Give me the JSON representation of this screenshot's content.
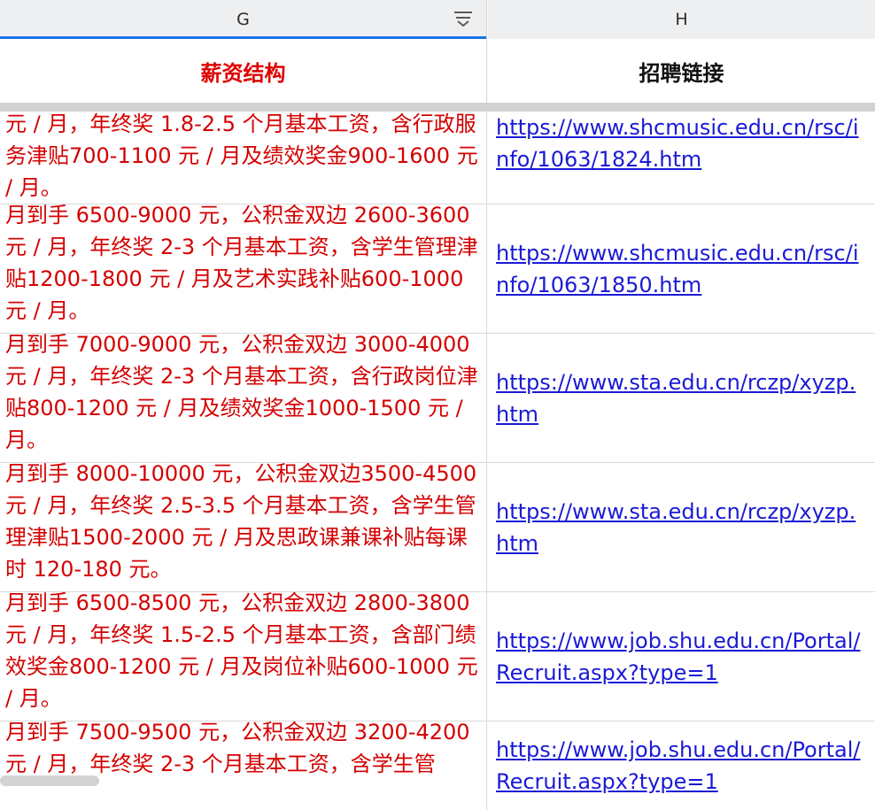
{
  "column_headers": {
    "g": "G",
    "h": "H"
  },
  "header_row": {
    "g": "薪资结构",
    "h": "招聘链接"
  },
  "icons": {
    "filter": "filter-dropdown-icon"
  },
  "colors": {
    "accent": "#1a73e8",
    "salary_text": "#d40000",
    "link": "#1a1ad6"
  },
  "rows": [
    {
      "salary": "元 / 月，年终奖 1.8-2.5 个月基本工资，含行政服务津贴700-1100 元 / 月及绩效奖金900-1600 元 / 月。",
      "link": "https://www.shcmusic.edu.cn/rsc/info/1063/1824.htm"
    },
    {
      "salary": "月到手 6500-9000 元，公积金双边 2600-3600 元 / 月，年终奖 2-3 个月基本工资，含学生管理津贴1200-1800 元 / 月及艺术实践补贴600-1000 元 / 月。",
      "link": "https://www.shcmusic.edu.cn/rsc/info/1063/1850.htm"
    },
    {
      "salary": "月到手 7000-9000 元，公积金双边 3000-4000 元 / 月，年终奖 2-3 个月基本工资，含行政岗位津贴800-1200 元 / 月及绩效奖金1000-1500 元 / 月。",
      "link": "https://www.sta.edu.cn/rczp/xyzp.htm"
    },
    {
      "salary": "月到手 8000-10000 元，公积金双边3500-4500 元 / 月，年终奖 2.5-3.5 个月基本工资，含学生管理津贴1500-2000 元 / 月及思政课兼课补贴每课时 120-180 元。",
      "link": "https://www.sta.edu.cn/rczp/xyzp.htm"
    },
    {
      "salary": "月到手 6500-8500 元，公积金双边 2800-3800 元 / 月，年终奖 1.5-2.5 个月基本工资，含部门绩效奖金800-1200 元 / 月及岗位补贴600-1000 元 / 月。",
      "link": "https://www.job.shu.edu.cn/Portal/Recruit.aspx?type=1"
    },
    {
      "salary": "月到手 7500-9500 元，公积金双边 3200-4200 元 / 月，年终奖 2-3 个月基本工资，含学生管",
      "link": "https://www.job.shu.edu.cn/Portal/Recruit.aspx?type=1"
    }
  ]
}
